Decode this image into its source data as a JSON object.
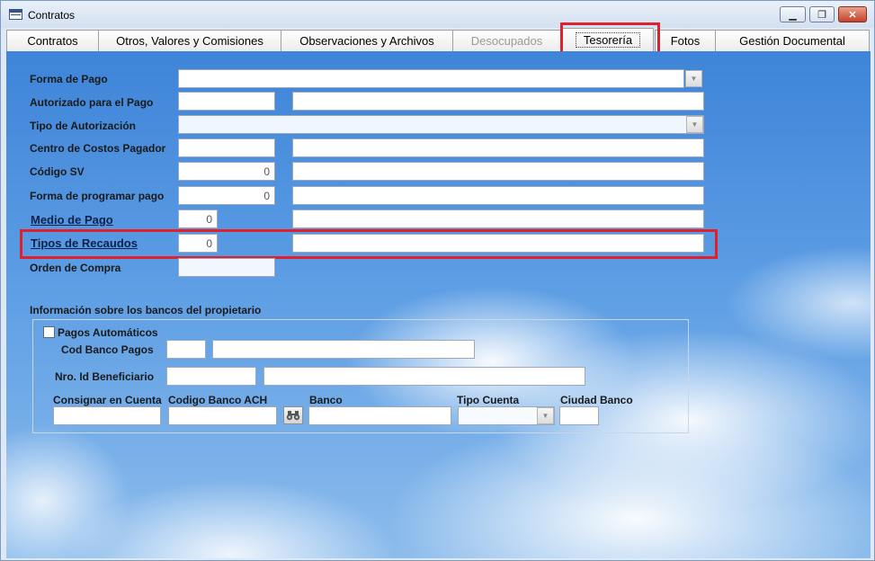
{
  "window": {
    "title": "Contratos"
  },
  "tabs": [
    {
      "label": "Contratos"
    },
    {
      "label": "Otros, Valores y Comisiones"
    },
    {
      "label": "Observaciones y Archivos"
    },
    {
      "label": "Desocupados"
    },
    {
      "label": "Tesorería"
    },
    {
      "label": "Fotos"
    },
    {
      "label": "Gestión Documental"
    }
  ],
  "form": {
    "forma_pago": {
      "label": "Forma de Pago"
    },
    "autorizado": {
      "label": "Autorizado para el Pago"
    },
    "tipo_autorizacion": {
      "label": "Tipo de Autorización"
    },
    "centro_costos": {
      "label": "Centro de Costos Pagador"
    },
    "codigo_sv": {
      "label": "Código SV",
      "value": "0"
    },
    "forma_programar": {
      "label": "Forma de programar pago",
      "value": "0"
    },
    "medio_pago": {
      "label": "Medio de Pago",
      "value": "0"
    },
    "tipos_recaudos": {
      "label": "Tipos de Recaudos",
      "value": "0"
    },
    "orden_compra": {
      "label": "Orden de Compra"
    }
  },
  "bancos": {
    "section_title": "Información sobre los bancos del propietario",
    "pagos_automaticos": {
      "label": "Pagos Automáticos",
      "checked": false
    },
    "cod_banco_pagos": {
      "label": "Cod Banco Pagos"
    },
    "nro_id_beneficiario": {
      "label": "Nro. Id Beneficiario"
    },
    "consignar_cuenta": {
      "label": "Consignar en Cuenta"
    },
    "codigo_banco_ach": {
      "label": "Codigo Banco ACH"
    },
    "banco": {
      "label": "Banco"
    },
    "tipo_cuenta": {
      "label": "Tipo Cuenta"
    },
    "ciudad_banco": {
      "label": "Ciudad Banco"
    }
  },
  "icons": [
    "table-icon",
    "minimize-icon",
    "restore-icon",
    "close-icon",
    "chevron-down-icon",
    "binoculars-icon"
  ],
  "colors": {
    "highlight": "#e0202a",
    "link_label": "#10204a"
  }
}
